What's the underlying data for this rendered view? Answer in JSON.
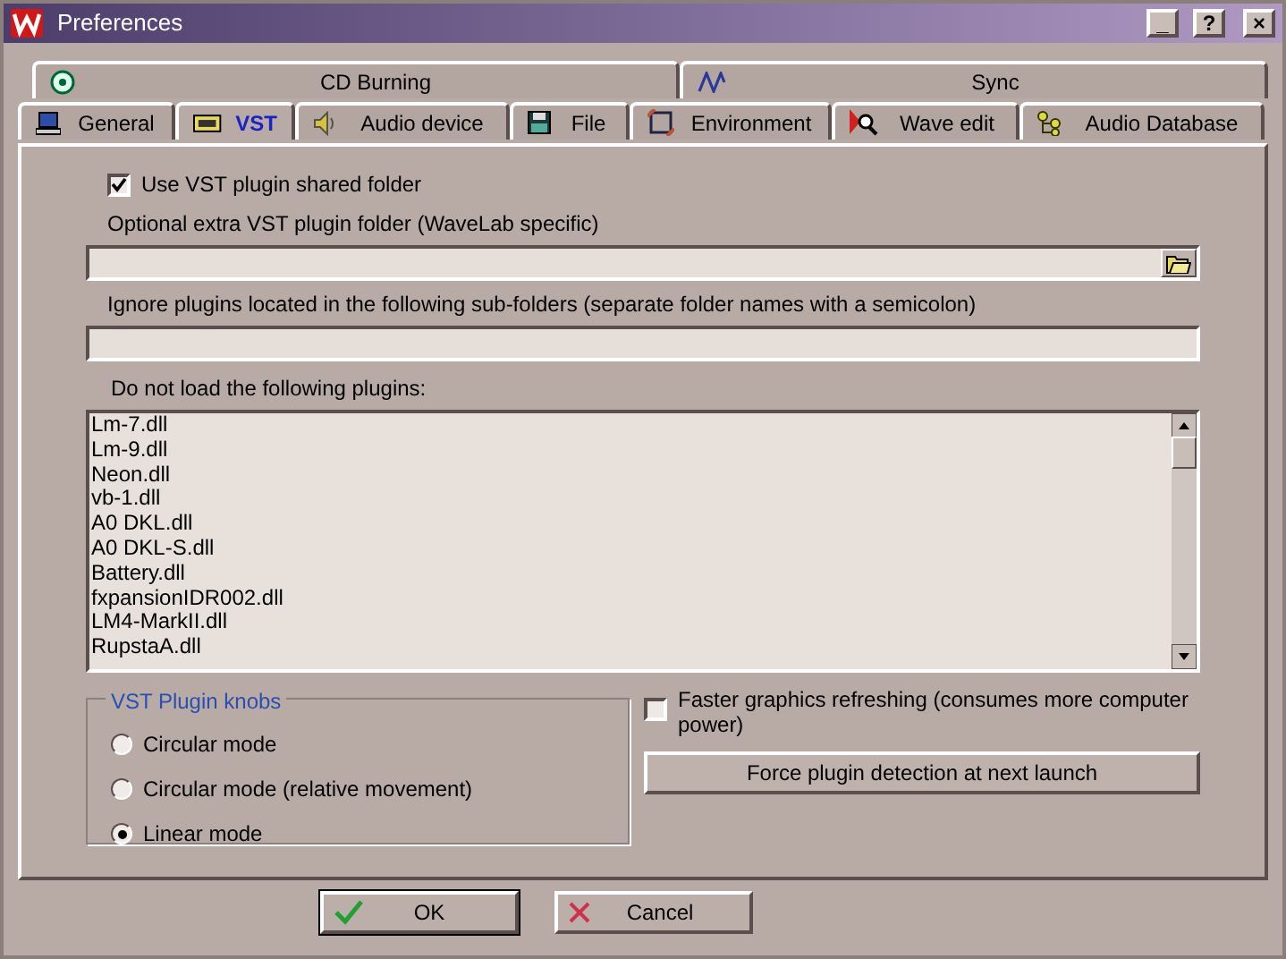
{
  "window": {
    "title": "Preferences",
    "controls": [
      "_",
      "?",
      "×"
    ]
  },
  "tab_rows": [
    [
      {
        "label": "CD Burning",
        "selected": false
      },
      {
        "label": "Sync",
        "selected": false
      }
    ],
    [
      {
        "label": "General",
        "selected": false
      },
      {
        "label": "VST",
        "selected": true
      },
      {
        "label": "Audio device",
        "selected": false
      },
      {
        "label": "File",
        "selected": false
      },
      {
        "label": "Environment",
        "selected": false
      },
      {
        "label": "Wave edit",
        "selected": false
      },
      {
        "label": "Audio Database",
        "selected": false
      }
    ]
  ],
  "use_shared_folder": {
    "label": "Use VST plugin shared folder",
    "checked": true
  },
  "extra_folder": {
    "label": "Optional extra VST plugin folder (WaveLab specific)"
  },
  "ignore_folders": {
    "label": "Ignore plugins located in the following sub-folders (separate folder names with a semicolon)"
  },
  "excluded_plugins": {
    "label": "Do not load the following plugins:",
    "items": [
      "Lm-7.dll",
      "Lm-9.dll",
      "Neon.dll",
      "vb-1.dll",
      "A0 DKL.dll",
      "A0 DKL-S.dll",
      "Battery.dll",
      "fxpansionIDR002.dll",
      "LM4-MarkII.dll",
      "RupstaA.dll"
    ]
  },
  "knobs": {
    "title": "VST Plugin knobs",
    "options": [
      {
        "label": "Circular mode",
        "selected": false
      },
      {
        "label": "Circular mode (relative movement)",
        "selected": false
      },
      {
        "label": "Linear mode",
        "selected": true
      }
    ]
  },
  "faster_graphics": {
    "label": "Faster graphics refreshing (consumes more computer power)",
    "checked": false
  },
  "force_detection": {
    "label": "Force plugin detection at next launch"
  },
  "buttons": [
    {
      "label": "OK",
      "kind": "ok"
    },
    {
      "label": "Cancel",
      "kind": "cancel"
    }
  ]
}
